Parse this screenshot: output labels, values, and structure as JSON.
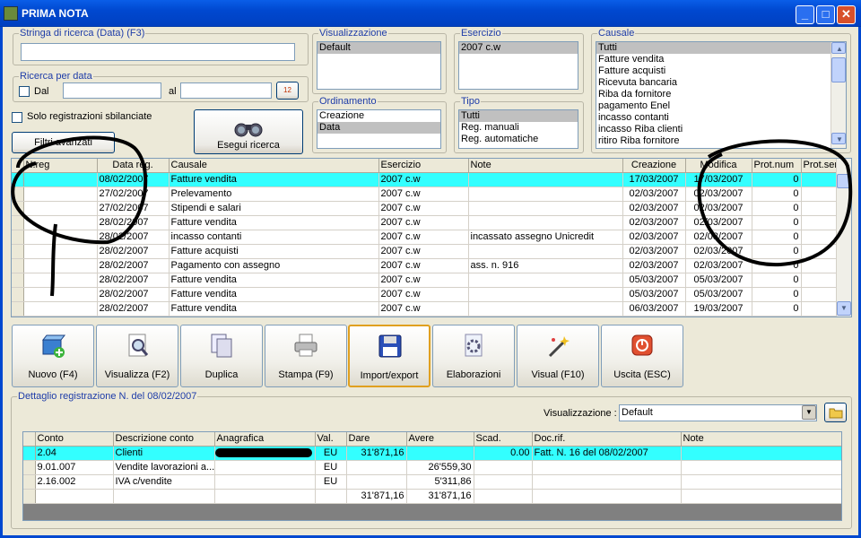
{
  "window": {
    "title": "PRIMA NOTA",
    "min": "_",
    "max": "□",
    "close": "✕"
  },
  "search": {
    "legend": "Stringa di ricerca (Data) (F3)",
    "value": ""
  },
  "date_search": {
    "legend": "Ricerca per data",
    "from_label": "Dal",
    "to_label": "al",
    "from_value": "",
    "to_value": "",
    "cal_icon": "12"
  },
  "unbalanced_label": "Solo registrazioni sbilanciate",
  "filter_button": "Filtri avanzati",
  "search_button": "Esegui ricerca",
  "visualizzazione": {
    "legend": "Visualizzazione",
    "items": [
      "Default"
    ]
  },
  "ordinamento": {
    "legend": "Ordinamento",
    "items": [
      "Creazione",
      "Data"
    ],
    "selected": 1
  },
  "esercizio": {
    "legend": "Esercizio",
    "items": [
      "2007 c.w"
    ]
  },
  "tipo": {
    "legend": "Tipo",
    "items": [
      "Tutti",
      "Reg. manuali",
      "Reg. automatiche"
    ]
  },
  "causale": {
    "legend": "Causale",
    "items": [
      "Tutti",
      "Fatture vendita",
      "Fatture acquisti",
      "Ricevuta bancaria",
      "Riba da fornitore",
      "pagamento Enel",
      "incasso contanti",
      "incasso Riba clienti",
      "ritiro Riba fornitore"
    ]
  },
  "main_grid": {
    "columns": [
      "N.reg",
      "Data reg.",
      "Causale",
      "Esercizio",
      "Note",
      "Creazione",
      "Modifica",
      "Prot.num",
      "Prot.serie"
    ],
    "rows": [
      [
        "",
        "08/02/2007",
        "Fatture vendita",
        "2007 c.w",
        "",
        "17/03/2007",
        "17/03/2007",
        "0",
        ""
      ],
      [
        "",
        "27/02/2007",
        "Prelevamento",
        "2007 c.w",
        "",
        "02/03/2007",
        "02/03/2007",
        "0",
        ""
      ],
      [
        "",
        "27/02/2007",
        "Stipendi e salari",
        "2007 c.w",
        "",
        "02/03/2007",
        "02/03/2007",
        "0",
        ""
      ],
      [
        "",
        "28/02/2007",
        "Fatture vendita",
        "2007 c.w",
        "",
        "02/03/2007",
        "02/03/2007",
        "0",
        ""
      ],
      [
        "",
        "28/02/2007",
        "incasso contanti",
        "2007 c.w",
        "incassato assegno Unicredit",
        "02/03/2007",
        "02/03/2007",
        "0",
        ""
      ],
      [
        "",
        "28/02/2007",
        "Fatture acquisti",
        "2007 c.w",
        "",
        "02/03/2007",
        "02/03/2007",
        "0",
        ""
      ],
      [
        "",
        "28/02/2007",
        "Pagamento con assegno",
        "2007 c.w",
        "ass. n. 916",
        "02/03/2007",
        "02/03/2007",
        "0",
        ""
      ],
      [
        "",
        "28/02/2007",
        "Fatture vendita",
        "2007 c.w",
        "",
        "05/03/2007",
        "05/03/2007",
        "0",
        ""
      ],
      [
        "",
        "28/02/2007",
        "Fatture vendita",
        "2007 c.w",
        "",
        "05/03/2007",
        "05/03/2007",
        "0",
        ""
      ],
      [
        "",
        "28/02/2007",
        "Fatture vendita",
        "2007 c.w",
        "",
        "06/03/2007",
        "19/03/2007",
        "0",
        ""
      ]
    ]
  },
  "toolbar": [
    {
      "label": "Nuovo (F4)",
      "icon": "new-box-icon"
    },
    {
      "label": "Visualizza (F2)",
      "icon": "magnifier-icon"
    },
    {
      "label": "Duplica",
      "icon": "duplicate-icon"
    },
    {
      "label": "Stampa (F9)",
      "icon": "printer-icon"
    },
    {
      "label": "Import/export",
      "icon": "floppy-icon"
    },
    {
      "label": "Elaborazioni",
      "icon": "gear-doc-icon"
    },
    {
      "label": "Visual (F10)",
      "icon": "magic-wand-icon"
    },
    {
      "label": "Uscita (ESC)",
      "icon": "power-icon"
    }
  ],
  "detail": {
    "legend": "Dettaglio registrazione N.  del 08/02/2007",
    "view_label": "Visualizzazione :",
    "view_value": "Default",
    "columns": [
      "Conto",
      "Descrizione conto",
      "Anagrafica",
      "Val.",
      "Dare",
      "Avere",
      "Scad.",
      "Doc.rif.",
      "Note"
    ],
    "rows": [
      [
        "2.04",
        "Clienti",
        "",
        "EU",
        "31'871,16",
        "",
        "0.00",
        "Fatt. N. 16 del 08/02/2007",
        ""
      ],
      [
        "9.01.007",
        "Vendite lavorazioni a...",
        "",
        "EU",
        "",
        "26'559,30",
        "",
        "",
        ""
      ],
      [
        "2.16.002",
        "IVA c/vendite",
        "",
        "EU",
        "",
        "5'311,86",
        "",
        "",
        ""
      ],
      [
        "",
        "",
        "",
        "",
        "31'871,16",
        "31'871,16",
        "",
        "",
        ""
      ]
    ]
  },
  "colors": {
    "title_bar": "#0048d0",
    "highlight_row": "#33ffff",
    "legend_text": "#1e3ca8",
    "annotation_ink": "#000000"
  }
}
